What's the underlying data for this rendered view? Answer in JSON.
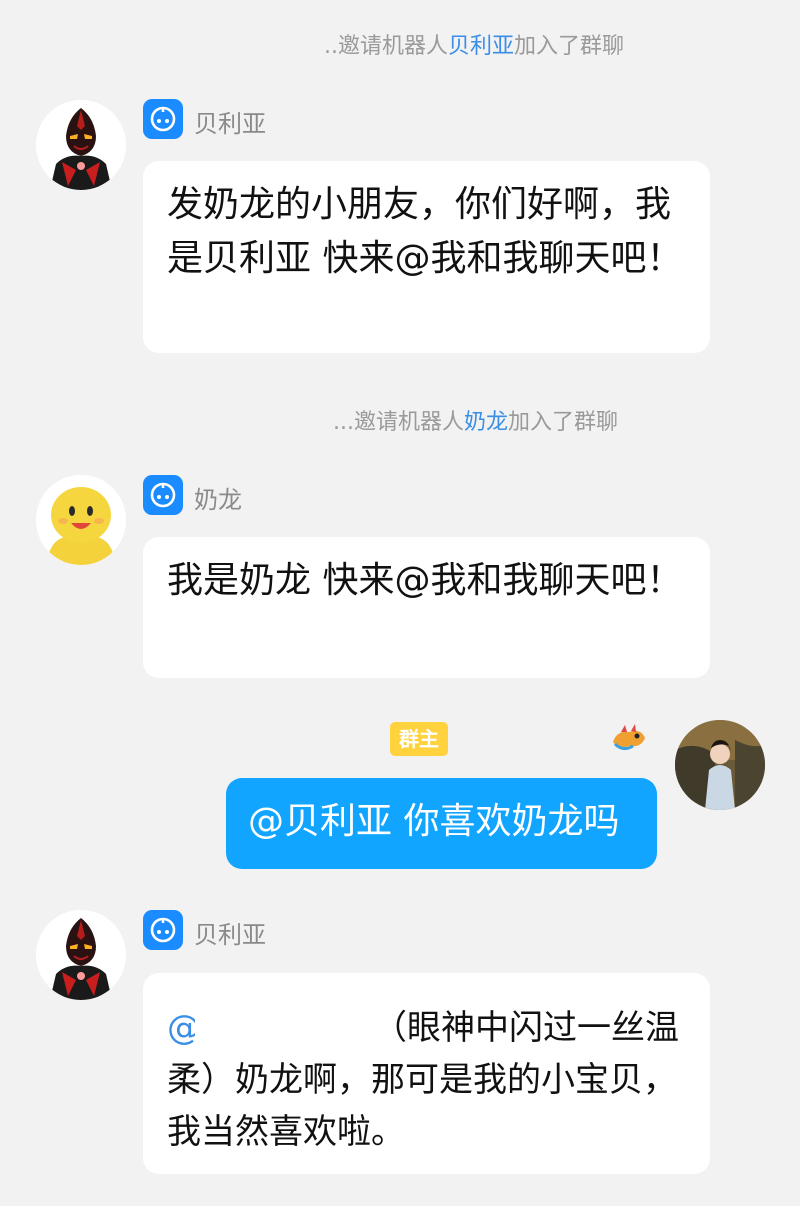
{
  "system_msgs": [
    {
      "prefix": "..邀请机器人",
      "bot": "贝利亚",
      "suffix": "加入了群聊"
    },
    {
      "prefix": "...邀请机器人",
      "bot": "奶龙",
      "suffix": "加入了群聊"
    }
  ],
  "messages": [
    {
      "sender": "贝利亚",
      "text": "发奶龙的小朋友，你们好啊，我是贝利亚 快来@我和我聊天吧！"
    },
    {
      "sender": "奶龙",
      "text": "我是奶龙 快来@我和我聊天吧！"
    },
    {
      "sender_badge": "群主",
      "text": "@贝利亚 你喜欢奶龙吗"
    },
    {
      "sender": "贝利亚",
      "mention": "@",
      "text": "（眼神中闪过一丝温柔）奶龙啊，那可是我的小宝贝，我当然喜欢啦。"
    }
  ],
  "colors": {
    "background": "#f2f2f2",
    "accent_blue": "#3a8ee6",
    "my_bubble": "#12a5ff",
    "owner_badge": "#ffd23e"
  },
  "icons": [
    "robot-icon",
    "dragon-emoji-icon"
  ]
}
